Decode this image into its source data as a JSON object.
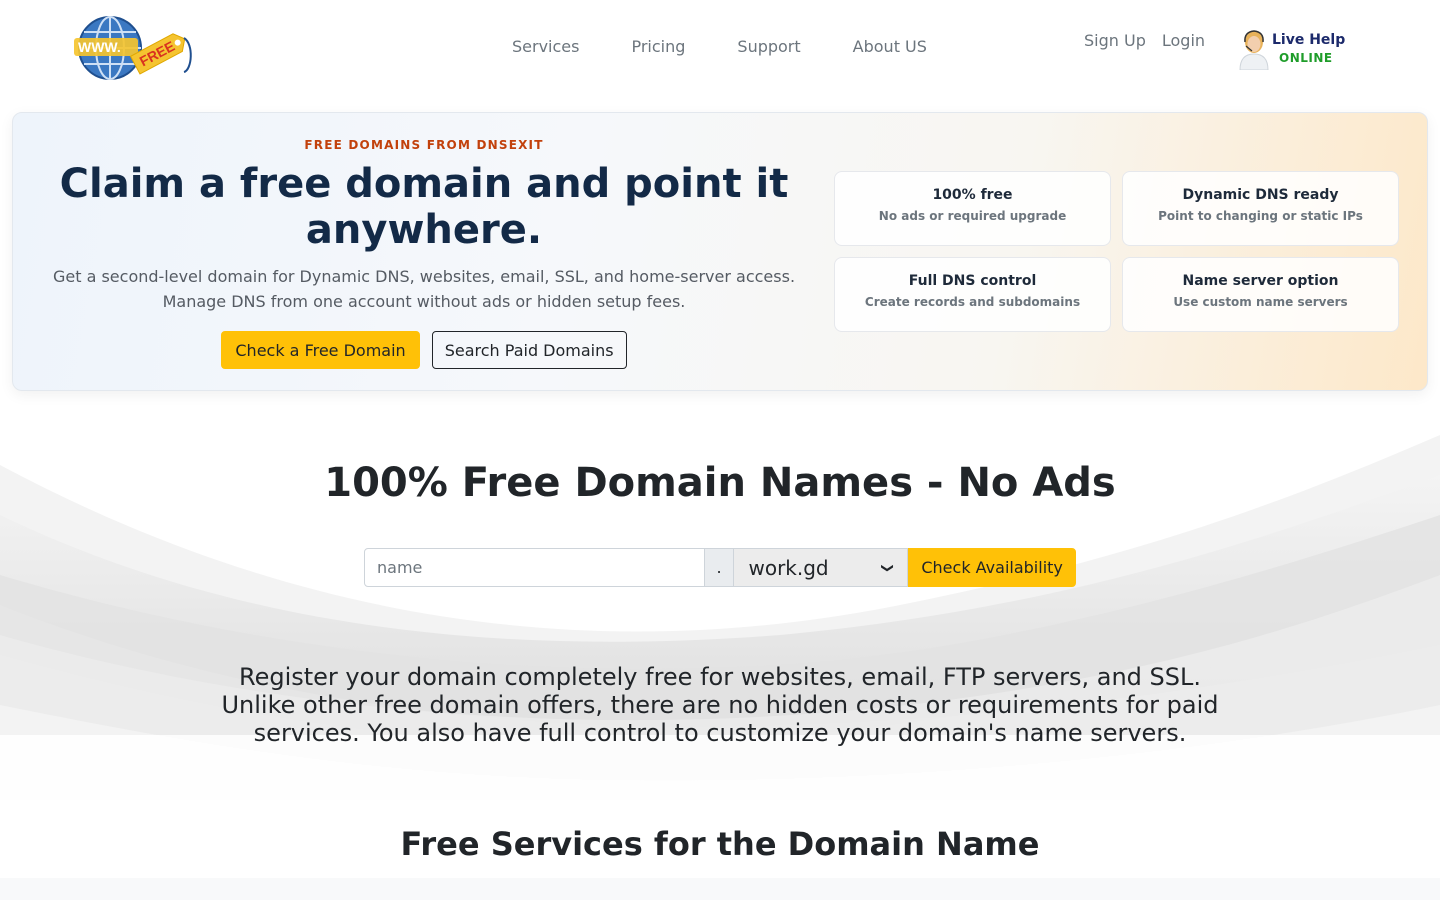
{
  "header": {
    "logo": {
      "www_text": "WWW.",
      "free_text": "FREE"
    },
    "nav": [
      "Services",
      "Pricing",
      "Support",
      "About US"
    ],
    "auth": {
      "signup": "Sign Up",
      "login": "Login"
    },
    "live_help": {
      "title": "Live Help",
      "status": "ONLINE"
    }
  },
  "hero": {
    "eyebrow": "FREE DOMAINS FROM DNSEXIT",
    "title": "Claim a free domain and point it anywhere.",
    "subtitle_line1": "Get a second-level domain for Dynamic DNS, websites, email, SSL, and home-server access.",
    "subtitle_line2": "Manage DNS from one account without ads or hidden setup fees.",
    "primary_button": "Check a Free Domain",
    "secondary_button": "Search Paid Domains",
    "features": [
      {
        "title": "100% free",
        "desc": "No ads or required upgrade"
      },
      {
        "title": "Dynamic DNS ready",
        "desc": "Point to changing or static IPs"
      },
      {
        "title": "Full DNS control",
        "desc": "Create records and subdomains"
      },
      {
        "title": "Name server option",
        "desc": "Use custom name servers"
      }
    ]
  },
  "search": {
    "title": "100% Free Domain Names - No Ads",
    "name_placeholder": "name",
    "dot": ".",
    "tld_selected": "work.gd",
    "check_button": "Check Availability",
    "description": "Register your domain completely free for websites, email, FTP servers, and SSL. Unlike other free domain offers, there are no hidden costs or requirements for paid services. You also have full control to customize your domain's name servers."
  },
  "services": {
    "title": "Free Services for the Domain Name"
  },
  "colors": {
    "accent": "#ffc107",
    "eyebrow": "#c2410c",
    "heading": "#132a47",
    "online": "#1f9d2a"
  }
}
